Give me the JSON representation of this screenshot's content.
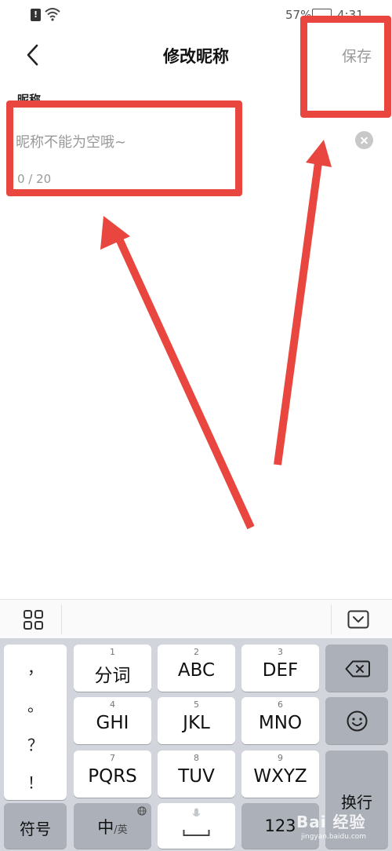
{
  "status_bar": {
    "battery_text": "57%",
    "time": "4:31"
  },
  "header": {
    "title": "修改昵称",
    "save_label": "保存"
  },
  "field": {
    "label": "昵称",
    "placeholder": "昵称不能为空哦~",
    "value": "",
    "counter": "0 / 20"
  },
  "keyboard": {
    "punctuation": [
      "，",
      "。",
      "？",
      "！"
    ],
    "keys": [
      {
        "num": "1",
        "label": "分词"
      },
      {
        "num": "2",
        "label": "ABC"
      },
      {
        "num": "3",
        "label": "DEF"
      },
      {
        "num": "4",
        "label": "GHI"
      },
      {
        "num": "5",
        "label": "JKL"
      },
      {
        "num": "6",
        "label": "MNO"
      },
      {
        "num": "7",
        "label": "PQRS"
      },
      {
        "num": "8",
        "label": "TUV"
      },
      {
        "num": "9",
        "label": "WXYZ"
      }
    ],
    "symbols_label": "符号",
    "lang_label": "中",
    "lang_sub": "/英",
    "num_label": "123",
    "enter_label": "换行"
  },
  "watermark": {
    "main": "Bai 经验",
    "sub": "jingyan.baidu.com"
  },
  "colors": {
    "annotation": "#e8463f",
    "keyboard_bg": "#d2d5db",
    "key_dark": "#abb0b9"
  }
}
